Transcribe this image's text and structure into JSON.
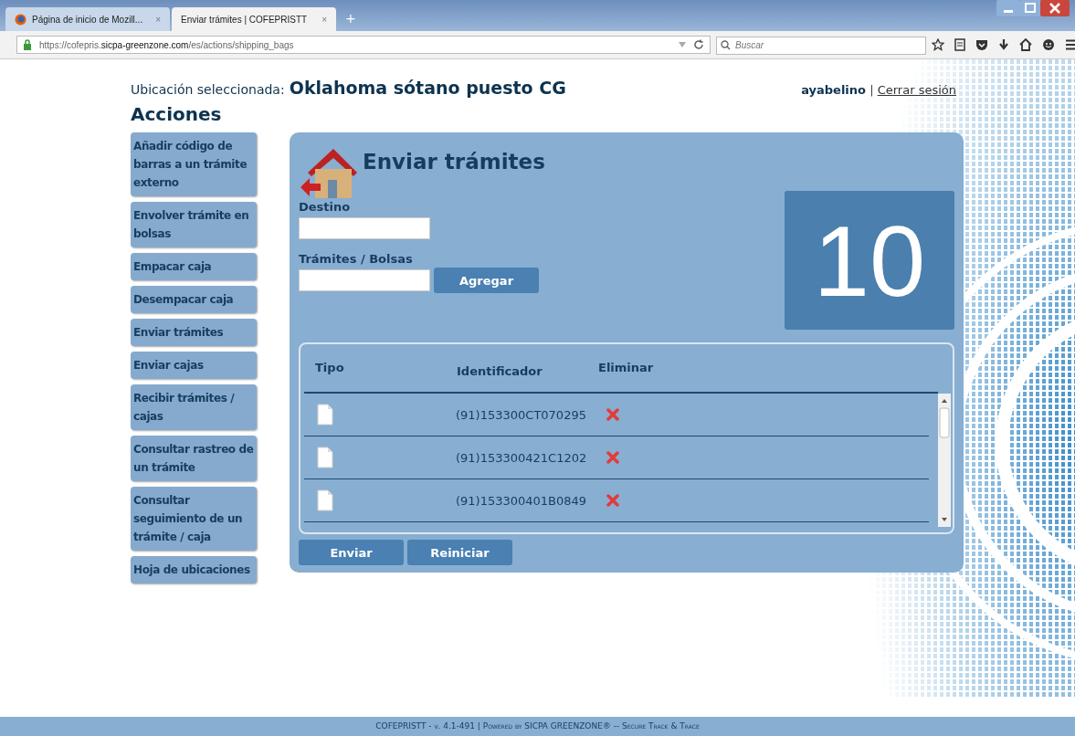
{
  "browser": {
    "tabs": [
      {
        "label": "Página de inicio de Mozill...",
        "selected": false,
        "close": "×"
      },
      {
        "label": "Enviar trámites | COFEPRISTT",
        "selected": true,
        "close": "×"
      }
    ],
    "new_tab": "+",
    "url": "https://cofepris.**sicpa-greenzone.com**/es/actions/shipping_bags",
    "search": {
      "placeholder": "Buscar"
    }
  },
  "header": {
    "location_label": "Ubicación seleccionada:",
    "location": "Oklahoma sótano puesto CG",
    "user": "ayabelino",
    "separator": "|",
    "logout": "Cerrar sesión"
  },
  "sidebar": {
    "title": "Acciones",
    "items": [
      {
        "label": "Añadir código de barras a un trámite externo"
      },
      {
        "label": "Envolver trámite en bolsas"
      },
      {
        "label": "Empacar caja"
      },
      {
        "label": "Desempacar caja"
      },
      {
        "label": "Enviar trámites"
      },
      {
        "label": "Enviar cajas"
      },
      {
        "label": "Recibir trámites / cajas"
      },
      {
        "label": "Consultar rastreo de un trámite"
      },
      {
        "label": "Consultar seguimiento de un trámite / caja"
      },
      {
        "label": "Hoja de ubicaciones"
      }
    ]
  },
  "panel": {
    "title": "Enviar trámites",
    "destino_label": "Destino",
    "tramites_label": "Trámites / Bolsas",
    "add_button": "Agregar",
    "count": "10",
    "table": {
      "columns": [
        "Tipo",
        "Identificador",
        "Eliminar"
      ],
      "rows": [
        {
          "id": "(91)153300CT070295"
        },
        {
          "id": "(91)153300421C1202"
        },
        {
          "id": "(91)153300401B0849"
        }
      ]
    },
    "buttons": [
      "Enviar",
      "Reiniciar"
    ]
  },
  "footer": "COFEPRISTT - v. 4.1-491 | Powered by SICPA GREENZONE® -- Secure Track & Trace"
}
